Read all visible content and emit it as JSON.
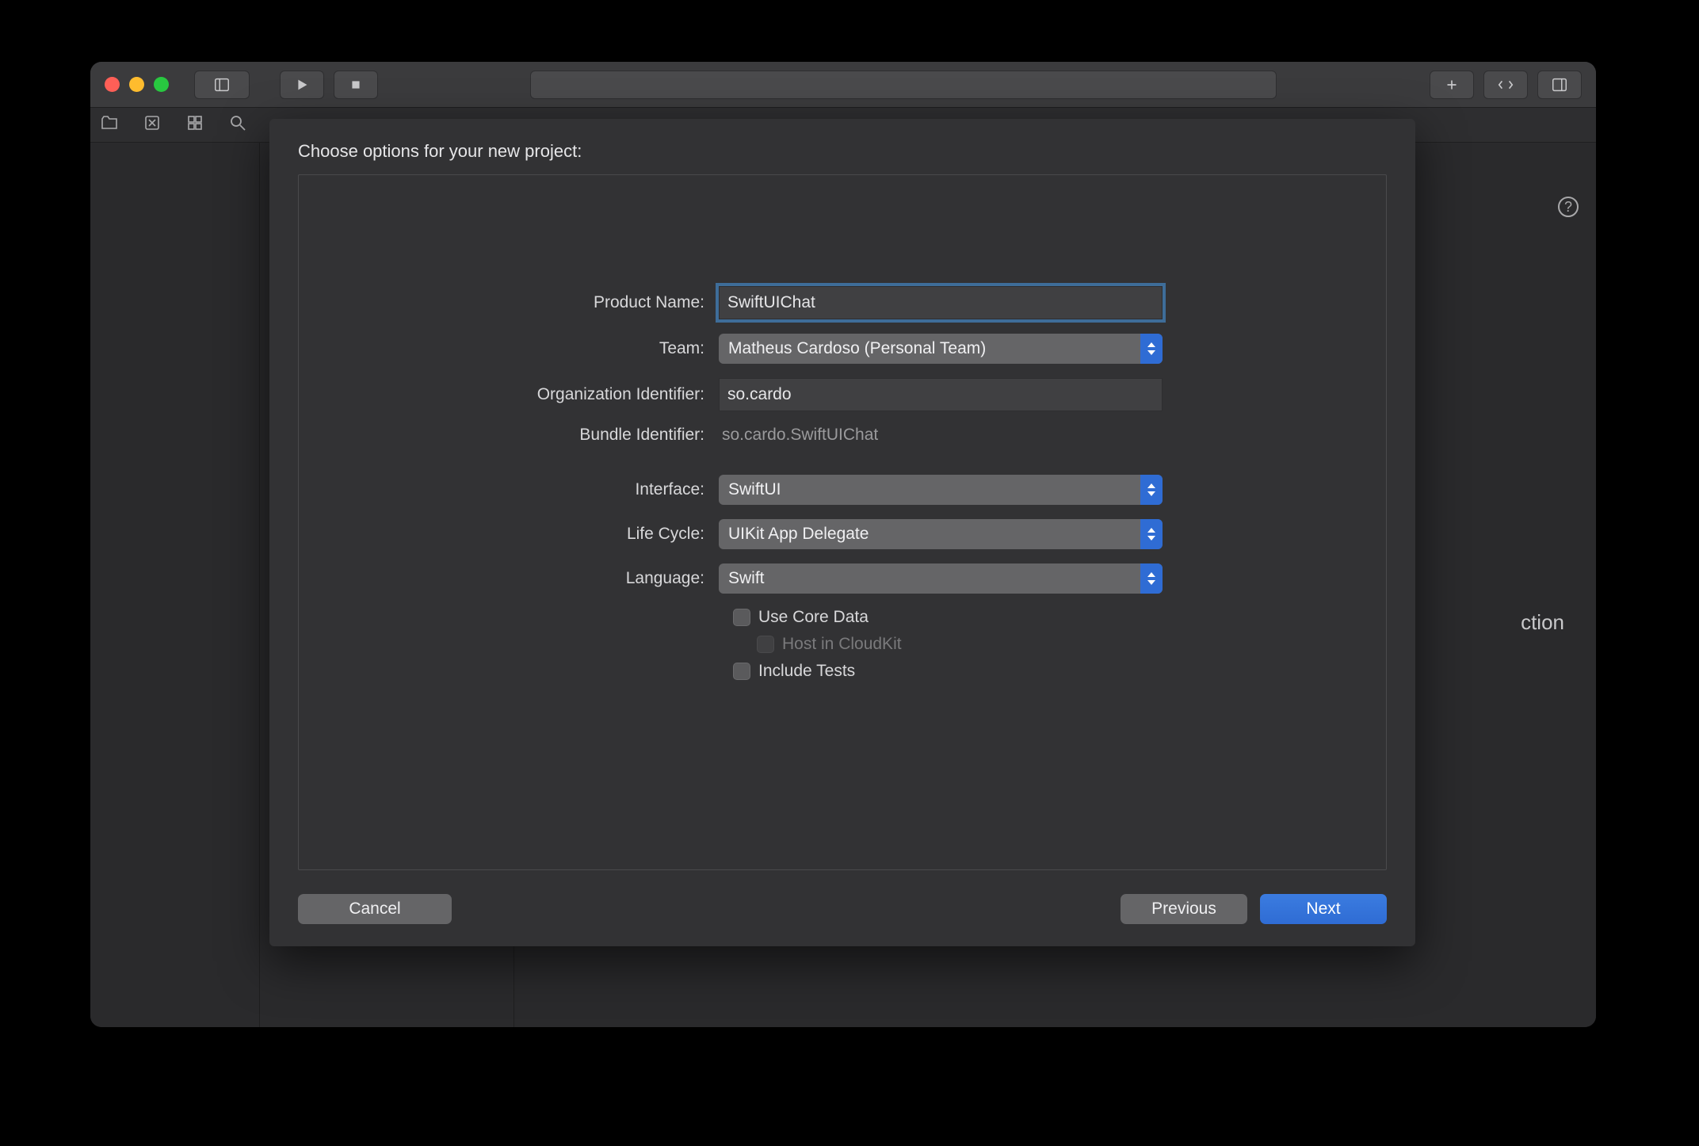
{
  "sheet": {
    "title": "Choose options for your new project:",
    "labels": {
      "product_name": "Product Name:",
      "team": "Team:",
      "org_identifier": "Organization Identifier:",
      "bundle_identifier": "Bundle Identifier:",
      "interface": "Interface:",
      "life_cycle": "Life Cycle:",
      "language": "Language:"
    },
    "values": {
      "product_name": "SwiftUIChat",
      "team": "Matheus Cardoso (Personal Team)",
      "org_identifier": "so.cardo",
      "bundle_identifier": "so.cardo.SwiftUIChat",
      "interface": "SwiftUI",
      "life_cycle": "UIKit App Delegate",
      "language": "Swift"
    },
    "checkboxes": {
      "use_core_data": "Use Core Data",
      "host_in_cloudkit": "Host in CloudKit",
      "include_tests": "Include Tests"
    },
    "buttons": {
      "cancel": "Cancel",
      "previous": "Previous",
      "next": "Next"
    }
  },
  "background_hint": "ction",
  "help_glyph": "?"
}
